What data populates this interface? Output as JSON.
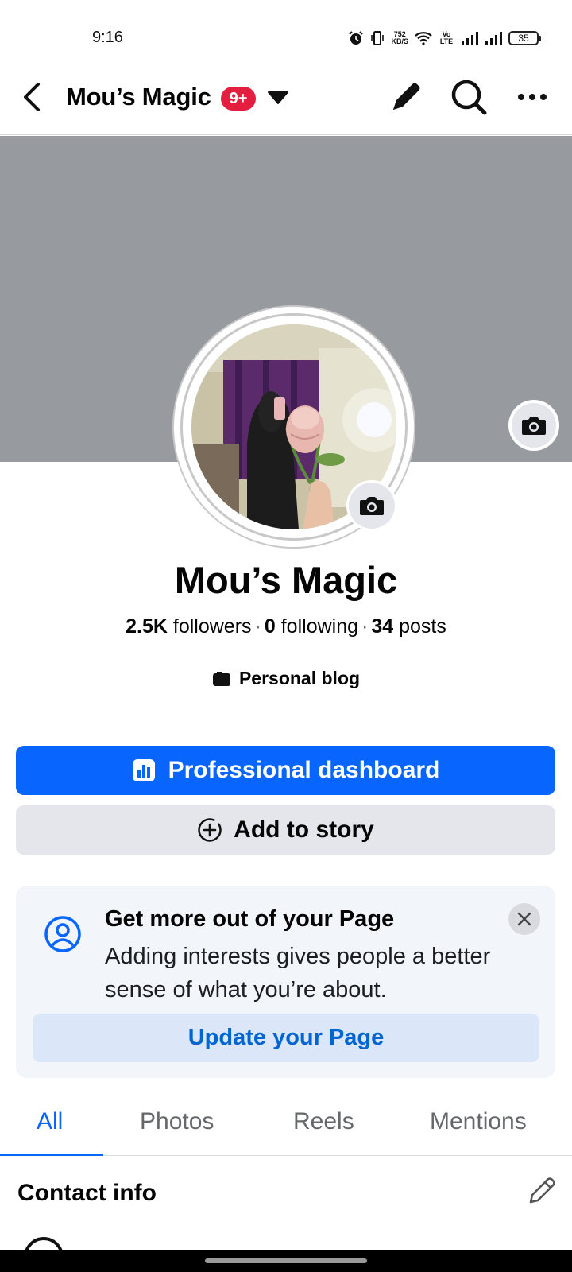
{
  "status_bar": {
    "time": "9:16",
    "net_speed_value": "752",
    "net_speed_unit": "KB/S",
    "volte": "Vo LTE",
    "battery": "35"
  },
  "header": {
    "title": "Mou’s Magic",
    "badge": "9+"
  },
  "profile": {
    "name": "Mou’s Magic",
    "followers_count": "2.5K",
    "followers_label": "followers",
    "following_count": "0",
    "following_label": "following",
    "posts_count": "34",
    "posts_label": "posts",
    "separator": "·",
    "category": "Personal blog"
  },
  "buttons": {
    "dashboard": "Professional dashboard",
    "add_story": "Add to story"
  },
  "promo_card": {
    "title": "Get more out of your Page",
    "body": "Adding interests gives people a better sense of what you’re about.",
    "action": "Update your Page"
  },
  "tabs": [
    {
      "label": "All",
      "active": true
    },
    {
      "label": "Photos",
      "active": false
    },
    {
      "label": "Reels",
      "active": false
    },
    {
      "label": "Mentions",
      "active": false
    }
  ],
  "contact": {
    "title": "Contact info"
  },
  "colors": {
    "brand_blue": "#0866ff",
    "badge_red": "#e41e3f",
    "cover_gray": "#979a9f"
  },
  "icons": [
    "back-arrow-icon",
    "caret-down-icon",
    "pencil-icon",
    "search-icon",
    "more-icon",
    "camera-icon",
    "bar-chart-icon",
    "add-circle-icon",
    "user-circle-icon",
    "close-icon",
    "blog-icon"
  ]
}
